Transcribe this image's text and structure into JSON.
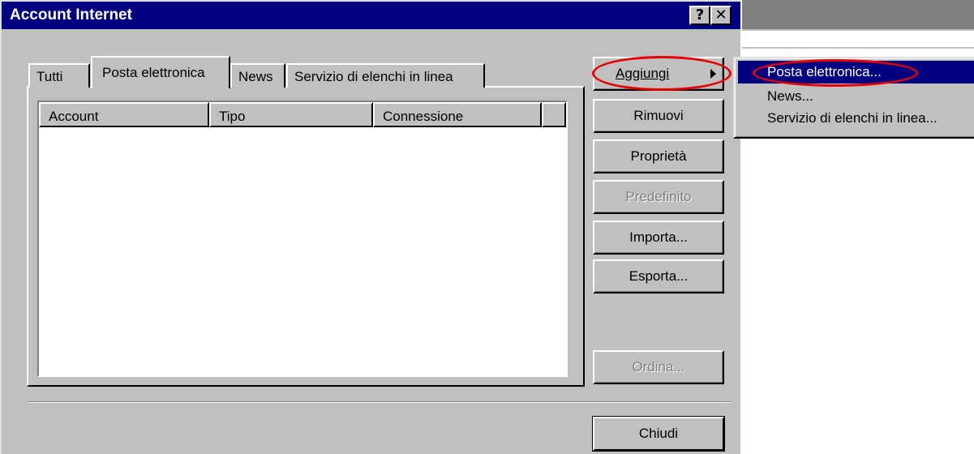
{
  "window": {
    "title": "Account Internet",
    "help_label": "?",
    "close_label": "✕"
  },
  "tabs": [
    {
      "label": "Tutti",
      "selected": false
    },
    {
      "label": "Posta elettronica",
      "selected": true
    },
    {
      "label": "News",
      "selected": false
    },
    {
      "label": "Servizio di elenchi in linea",
      "selected": false
    }
  ],
  "list": {
    "columns": [
      "Account",
      "Tipo",
      "Connessione",
      ""
    ],
    "rows": []
  },
  "buttons": {
    "aggiungi": "Aggiungi",
    "rimuovi": "Rimuovi",
    "proprieta": "Proprietà",
    "predefinito": "Predefinito",
    "importa": "Importa...",
    "esporta": "Esporta...",
    "ordina": "Ordina...",
    "chiudi": "Chiudi"
  },
  "menu": {
    "items": [
      {
        "label": "Posta elettronica...",
        "selected": true
      },
      {
        "label": "News...",
        "selected": false
      },
      {
        "label": "Servizio di elenchi in linea...",
        "selected": false
      }
    ]
  },
  "colors": {
    "titlebar": "#000080",
    "face": "#c0c0c0",
    "highlight_annotation": "#e60000"
  }
}
